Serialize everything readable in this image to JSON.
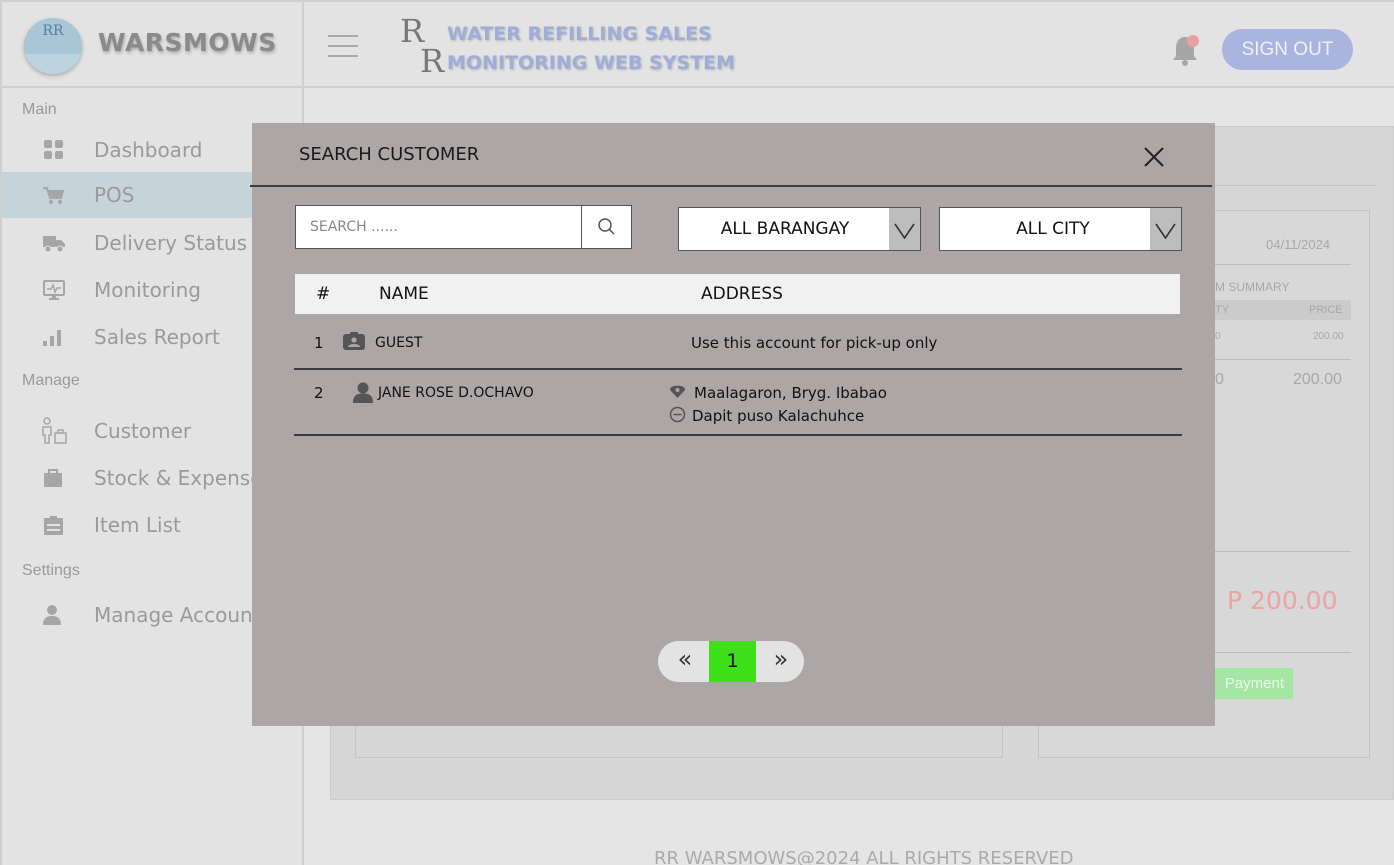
{
  "app": {
    "logo_text": "RR",
    "brand_name": "WARSMOWS",
    "monogram": [
      "R",
      "R"
    ],
    "system_title_line1": "WATER REFILLING SALES",
    "system_title_line2": "MONITORING WEB SYSTEM",
    "signout_label": "SIGN OUT"
  },
  "sidebar": {
    "sections": {
      "main": "Main",
      "manage": "Manage",
      "settings": "Settings"
    },
    "items": [
      {
        "label": "Dashboard",
        "icon": "grid-icon"
      },
      {
        "label": "POS",
        "icon": "cart-icon",
        "active": true
      },
      {
        "label": "Delivery Status",
        "icon": "truck-icon"
      },
      {
        "label": "Monitoring",
        "icon": "monitor-icon"
      },
      {
        "label": "Sales Report",
        "icon": "bar-chart-icon"
      },
      {
        "label": "Customer",
        "icon": "customer-icon"
      },
      {
        "label": "Stock & Expense",
        "icon": "briefcase-icon"
      },
      {
        "label": "Item List",
        "icon": "clipboard-icon"
      },
      {
        "label": "Manage Account",
        "icon": "user-icon"
      }
    ]
  },
  "background": {
    "date": "04/11/2024",
    "summary_label": "M SUMMARY",
    "col_qty": "TY",
    "col_price": "PRICE",
    "item_qty": "0",
    "item_price": "200.00",
    "subtotal_qty": "0",
    "subtotal_price": "200.00",
    "total": "P 200.00",
    "payment_label": "Payment",
    "footer": "RR WARSMOWS@2024 ALL RIGHTS RESERVED"
  },
  "modal": {
    "title": "SEARCH CUSTOMER",
    "search_placeholder": "SEARCH ......",
    "barangay_filter": "ALL BARANGAY",
    "city_filter": "ALL CITY",
    "columns": {
      "num": "#",
      "name": "NAME",
      "address": "ADDRESS"
    },
    "rows": [
      {
        "num": "1",
        "name": "GUEST",
        "icon": "id-badge-icon",
        "address": [
          "Use this account for pick-up only"
        ]
      },
      {
        "num": "2",
        "name": "JANE ROSE D.OCHAVO",
        "icon": "person-icon",
        "address": [
          "Maalagaron, Bryg. Ibabao",
          "Dapit puso Kalachuhce"
        ]
      }
    ],
    "pagination": {
      "prev": "«",
      "current": "1",
      "next": "»"
    }
  },
  "colors": {
    "modal_bg": "#ada6a6",
    "active_page": "#3ee01a",
    "signout": "#aab4de",
    "title_blue": "#9faed8",
    "total_red": "#e9a4a4"
  }
}
